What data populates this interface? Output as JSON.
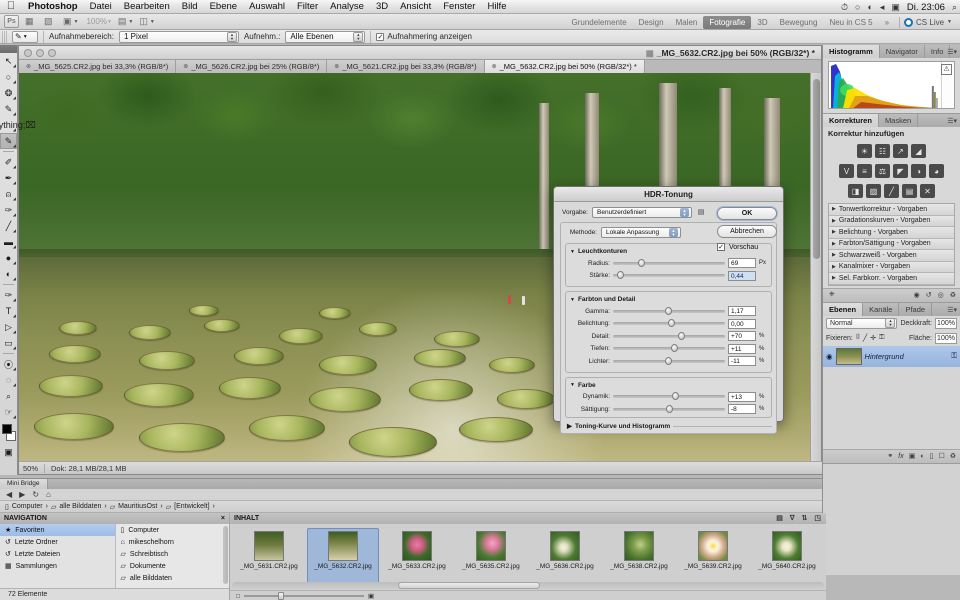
{
  "macbar": {
    "apple": "apple-logo",
    "items": [
      "Photoshop",
      "Datei",
      "Bearbeiten",
      "Bild",
      "Ebene",
      "Auswahl",
      "Filter",
      "Analyse",
      "3D",
      "Ansicht",
      "Fenster",
      "Hilfe"
    ],
    "right_icons": [
      "◔",
      "⏲",
      "↻",
      "◑",
      "◂",
      "▣"
    ],
    "clock": "Di. 23:06",
    "search_icon": "⌕"
  },
  "appbar": {
    "logo": "Ps",
    "zoom_value": "100%",
    "buttons": [
      "bridge-icon",
      "mini-bridge-icon",
      "view-extras-icon",
      "zoom-level",
      "arrange-icon",
      "screen-mode-icon"
    ],
    "workspaces": [
      "Grundelemente",
      "Design",
      "Malen",
      "Fotografie",
      "3D",
      "Bewegung",
      "Neu in CS 5"
    ],
    "workspace_active": "Fotografie",
    "overflow": "»",
    "cslive": "CS Live"
  },
  "optionsbar": {
    "tool_icon": "eyedropper-icon",
    "sample_size_label": "Aufnahmebereich:",
    "sample_size_value": "1 Pixel",
    "sample_label": "Aufnehm.:",
    "sample_value": "Alle Ebenen",
    "show_ring_label": "Aufnahmering anzeigen",
    "show_ring_checked": "✓"
  },
  "toolbar": {
    "tools": [
      {
        "name": "move-tool",
        "glyph": "↖"
      },
      {
        "name": "marquee-tool",
        "glyph": "○"
      },
      {
        "name": "lasso-tool",
        "glyph": "❂"
      },
      {
        "name": "quick-selection-tool",
        "glyph": "✎"
      },
      {
        "name": "crop-tool",
        "glyph": "⌗"
      },
      {
        "name": "eyedropper-tool",
        "glyph": "✒"
      },
      {
        "name": "healing-brush-tool",
        "glyph": "✐"
      },
      {
        "name": "brush-tool",
        "glyph": "✏"
      },
      {
        "name": "clone-stamp-tool",
        "glyph": "⚓"
      },
      {
        "name": "history-brush-tool",
        "glyph": "⚑"
      },
      {
        "name": "eraser-tool",
        "glyph": "╱"
      },
      {
        "name": "gradient-tool",
        "glyph": "■"
      },
      {
        "name": "blur-tool",
        "glyph": "●"
      },
      {
        "name": "dodge-tool",
        "glyph": "◐"
      },
      {
        "name": "pen-tool",
        "glyph": "✑"
      },
      {
        "name": "type-tool",
        "glyph": "T"
      },
      {
        "name": "path-selection-tool",
        "glyph": "⬉"
      },
      {
        "name": "rectangle-tool",
        "glyph": "▭"
      },
      {
        "name": "3d-rotate-tool",
        "glyph": "⦿"
      },
      {
        "name": "3d-orbit-tool",
        "glyph": "◌"
      },
      {
        "name": "zoom-tool",
        "glyph": "⌕"
      },
      {
        "name": "hand-tool",
        "glyph": "☞"
      }
    ],
    "selected_index": 5,
    "quickmask_glyph": "▣"
  },
  "document": {
    "title": "_MG_5632.CR2.jpg bei 50% (RGB/32*) *",
    "tabs": [
      {
        "label": "_MG_5625.CR2.jpg bei 33,3% (RGB/8*)",
        "active": false
      },
      {
        "label": "_MG_5626.CR2.jpg bei 25% (RGB/8*)",
        "active": false
      },
      {
        "label": "_MG_5621.CR2.jpg bei 33,3% (RGB/8*)",
        "active": false
      },
      {
        "label": "_MG_5632.CR2.jpg bei 50% (RGB/32*) *",
        "active": true
      }
    ],
    "close_glyph": "⊗",
    "statusbar": {
      "zoom": "50%",
      "doc_info": "Dok: 28,1 MB/28,1 MB"
    }
  },
  "hdr_dialog": {
    "title": "HDR-Tonung",
    "preset_label": "Vorgabe:",
    "preset_value": "Benutzerdefiniert",
    "preset_icon": "preset-menu-icon",
    "method_label": "Methode:",
    "method_value": "Lokale Anpassung",
    "buttons": {
      "ok": "OK",
      "cancel": "Abbrechen"
    },
    "preview_label": "Vorschau",
    "preview_checked": "✓",
    "groups": [
      {
        "title": "Leuchtkonturen",
        "sliders": [
          {
            "label": "Radius:",
            "value": "69",
            "unit": "Px",
            "pos": 22,
            "highlight": false
          },
          {
            "label": "Stärke:",
            "value": "0,44",
            "unit": "",
            "pos": 4,
            "highlight": true
          }
        ]
      },
      {
        "title": "Farbton und Detail",
        "sliders": [
          {
            "label": "Gamma:",
            "value": "1,17",
            "unit": "",
            "pos": 46,
            "highlight": false
          },
          {
            "label": "Belichtung:",
            "value": "0,00",
            "unit": "",
            "pos": 49,
            "highlight": false
          },
          {
            "label": "Detail:",
            "value": "+70",
            "unit": "%",
            "pos": 58,
            "highlight": false
          },
          {
            "label": "Tiefen:",
            "value": "+11",
            "unit": "%",
            "pos": 52,
            "highlight": false
          },
          {
            "label": "Lichter:",
            "value": "-11",
            "unit": "%",
            "pos": 46,
            "highlight": false
          }
        ]
      },
      {
        "title": "Farbe",
        "sliders": [
          {
            "label": "Dynamik:",
            "value": "+13",
            "unit": "%",
            "pos": 53,
            "highlight": false
          },
          {
            "label": "Sättigung:",
            "value": "-8",
            "unit": "%",
            "pos": 47,
            "highlight": false
          }
        ]
      }
    ],
    "curve_section": "Toning-Kurve und Histogramm"
  },
  "dock": {
    "histogram_panel": {
      "tabs": [
        "Histogramm",
        "Navigator",
        "Info"
      ],
      "active_tab": "Histogramm",
      "warning_icon": "⚠"
    },
    "adjustments_panel": {
      "tabs": [
        "Korrekturen",
        "Masken"
      ],
      "active_tab": "Korrekturen",
      "heading": "Korrektur hinzufügen",
      "buttons": [
        {
          "name": "brightness-contrast-icon",
          "glyph": "☀"
        },
        {
          "name": "levels-icon",
          "glyph": "☷"
        },
        {
          "name": "curves-icon",
          "glyph": "↗"
        },
        {
          "name": "exposure-icon",
          "glyph": "◢"
        },
        {
          "name": "vibrance-icon",
          "glyph": "V"
        },
        {
          "name": "hue-saturation-icon",
          "glyph": "≡"
        },
        {
          "name": "color-balance-icon",
          "glyph": "⚖"
        },
        {
          "name": "black-white-icon",
          "glyph": "◤"
        },
        {
          "name": "photo-filter-icon",
          "glyph": "◑"
        },
        {
          "name": "channel-mixer-icon",
          "glyph": "◕"
        },
        {
          "name": "invert-icon",
          "glyph": "◨"
        },
        {
          "name": "posterize-icon",
          "glyph": "▨"
        },
        {
          "name": "threshold-icon",
          "glyph": "╱"
        },
        {
          "name": "gradient-map-icon",
          "glyph": "▤"
        },
        {
          "name": "selective-color-icon",
          "glyph": "✕"
        }
      ],
      "presets": [
        "Tonwertkorrektur - Vorgaben",
        "Gradationskurven - Vorgaben",
        "Belichtung - Vorgaben",
        "Farbton/Sättigung - Vorgaben",
        "Schwarzweiß - Vorgaben",
        "Kanalmixer - Vorgaben",
        "Sel. Farbkorr. - Vorgaben"
      ],
      "footer_icons": [
        "clip-layer-icon",
        "view-previous-icon",
        "reset-icon",
        "toggle-visibility-icon",
        "delete-icon"
      ]
    },
    "layers_panel": {
      "tabs": [
        "Ebenen",
        "Kanäle",
        "Pfade"
      ],
      "active_tab": "Ebenen",
      "blend_mode": "Normal",
      "opacity_label": "Deckkraft:",
      "opacity_value": "100%",
      "lock_label": "Fixieren:",
      "lock_icons": [
        "⌷",
        "╱",
        "✛",
        "⚿"
      ],
      "fill_label": "Fläche:",
      "fill_value": "100%",
      "layers": [
        {
          "name": "Hintergrund",
          "locked_icon": "⚿",
          "visible_icon": "◉"
        }
      ],
      "footer_icons": [
        "link-icon",
        "fx-icon",
        "mask-icon",
        "adjustment-icon",
        "group-icon",
        "new-layer-icon",
        "delete-layer-icon"
      ]
    }
  },
  "mini_bridge": {
    "tab": "Mini Bridge",
    "nav_icons": [
      "◀",
      "▶",
      "↻",
      "⌂"
    ],
    "breadcrumbs": [
      {
        "label": "Computer",
        "icon": "▯"
      },
      {
        "label": "alle Bilddaten",
        "icon": "▱"
      },
      {
        "label": "MauritiusOst",
        "icon": "▱"
      },
      {
        "label": "[Entwickelt]",
        "icon": "▱"
      }
    ],
    "breadcrumb_sep": "›",
    "navigation": {
      "header": "NAVIGATION",
      "close_glyph": "×",
      "left_items": [
        {
          "label": "Favoriten",
          "icon": "★",
          "selected": true
        },
        {
          "label": "Letzte Ordner",
          "icon": "↺",
          "selected": false
        },
        {
          "label": "Letzte Dateien",
          "icon": "↺",
          "selected": false
        },
        {
          "label": "Sammlungen",
          "icon": "▦",
          "selected": false
        }
      ],
      "right_items": [
        {
          "label": "Computer",
          "icon": "▯"
        },
        {
          "label": "mikeschelhorn",
          "icon": "⌂"
        },
        {
          "label": "Schreibtisch",
          "icon": "▱"
        },
        {
          "label": "Dokumente",
          "icon": "▱"
        },
        {
          "label": "alle Bilddaten",
          "icon": "▱"
        }
      ]
    },
    "footer": "72 Elemente",
    "content": {
      "header": "INHALT",
      "tool_icons": [
        "▤",
        "∇",
        "⇅",
        "◳"
      ],
      "items": [
        {
          "name": "_MG_5631.CR2.jpg",
          "selected": false,
          "kind": "pond"
        },
        {
          "name": "_MG_5632.CR2.jpg",
          "selected": true,
          "kind": "pond"
        },
        {
          "name": "_MG_5633.CR2.jpg",
          "selected": false,
          "kind": "flower-pink"
        },
        {
          "name": "_MG_5635.CR2.jpg",
          "selected": false,
          "kind": "flower-pink"
        },
        {
          "name": "_MG_5636.CR2.jpg",
          "selected": false,
          "kind": "flower-white"
        },
        {
          "name": "_MG_5638.CR2.jpg",
          "selected": false,
          "kind": "leaf"
        },
        {
          "name": "_MG_5639.CR2.jpg",
          "selected": false,
          "kind": "flower-yellow"
        },
        {
          "name": "_MG_5640.CR2.jpg",
          "selected": false,
          "kind": "flower-white"
        }
      ],
      "zoom_small": "□",
      "zoom_large": "▣"
    }
  },
  "colors": {
    "accent_blue": "#9fb8d9",
    "selection_blue": "#aec6e8",
    "panel_gray": "#d2d2d2",
    "dark_gray": "#4a4a4a"
  }
}
